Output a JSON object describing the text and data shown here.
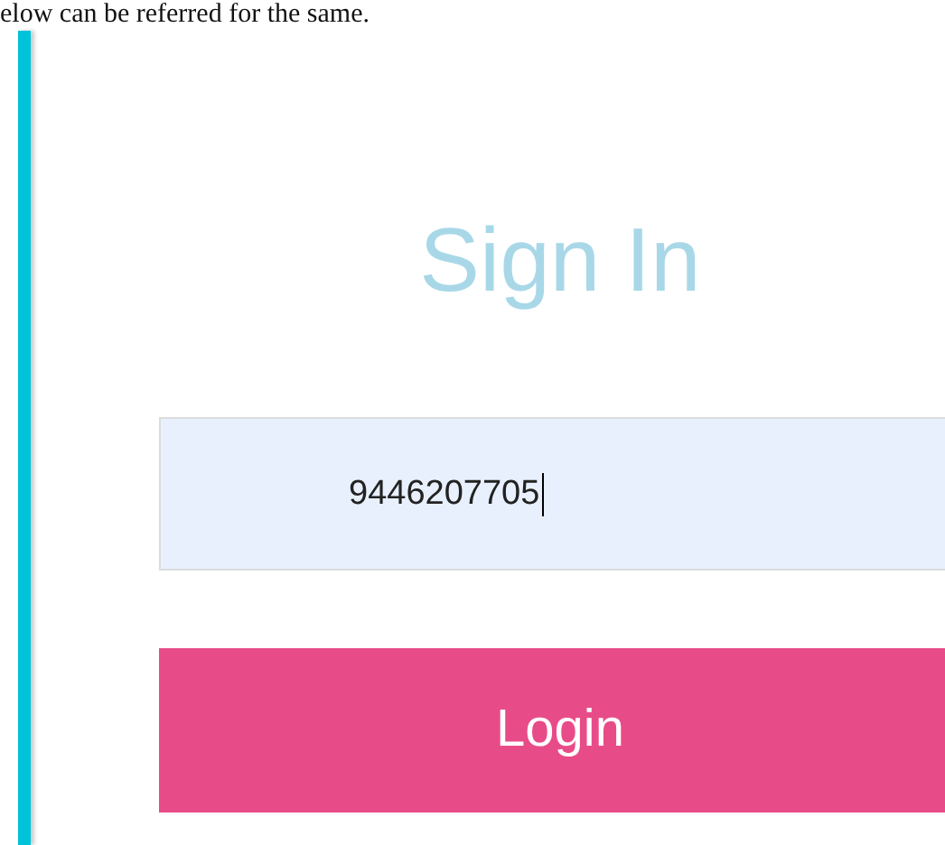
{
  "intro_text": "elow can be referred for the same.",
  "form": {
    "title": "Sign In",
    "phone_field": {
      "value": "9446207705"
    },
    "button": "Login"
  }
}
